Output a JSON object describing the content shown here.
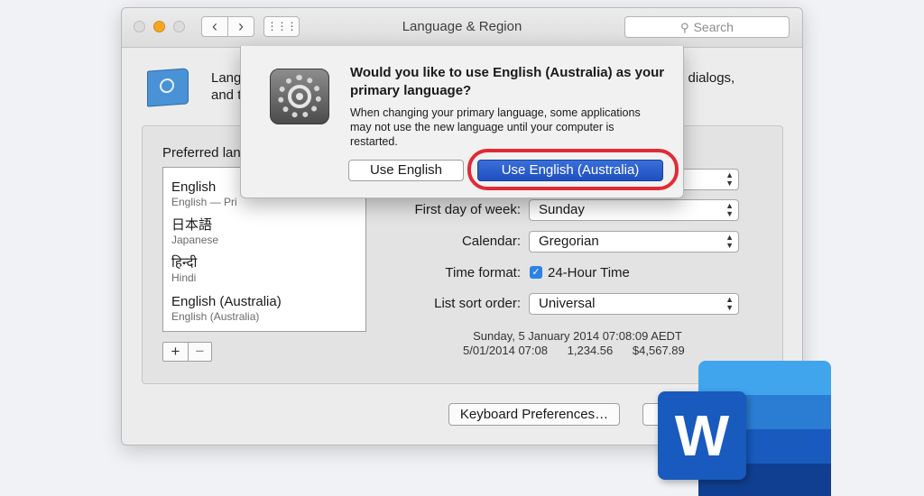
{
  "window": {
    "title": "Language & Region",
    "search_placeholder": "Search",
    "back_glyph": "‹",
    "forward_glyph": "›",
    "grid_glyph": "⋮⋮⋮"
  },
  "intro": {
    "line1_left": "Lang",
    "line2_left": "and t",
    "line1_right": "d dialogs,"
  },
  "preferred_languages": {
    "label": "Preferred lan",
    "items": [
      {
        "name": "English",
        "sub": "English — Pri"
      },
      {
        "name": "日本語",
        "sub": "Japanese"
      },
      {
        "name": "हिन्दी",
        "sub": "Hindi"
      },
      {
        "name": "English (Australia)",
        "sub": "English (Australia)"
      }
    ],
    "add_label": "+",
    "remove_label": "−"
  },
  "settings": {
    "first_day_label": "First day of week:",
    "first_day_value": "Sunday",
    "calendar_label": "Calendar:",
    "calendar_value": "Gregorian",
    "time_format_label": "Time format:",
    "time_format_value": "24-Hour Time",
    "time_format_checked": true,
    "list_sort_label": "List sort order:",
    "list_sort_value": "Universal",
    "sample_date": "Sunday, 5 January 2014 07:08:09 AEDT",
    "sample_short": "5/01/2014 07:08      1,234.56      $4,567.89"
  },
  "buttons": {
    "keyboard_prefs": "Keyboard Preferences…"
  },
  "dialog": {
    "title": "Would you like to use English (Australia) as your primary language?",
    "message": "When changing your primary language, some applications may not use the new language until your computer is restarted.",
    "secondary_button": "Use English",
    "primary_button": "Use English (Australia)"
  },
  "word_logo": {
    "letter": "W"
  },
  "colors": {
    "highlight_ring": "#e22a35",
    "primary_button": "#1f4fc0",
    "checkbox": "#2d82e6",
    "word_blue": "#185abd"
  }
}
